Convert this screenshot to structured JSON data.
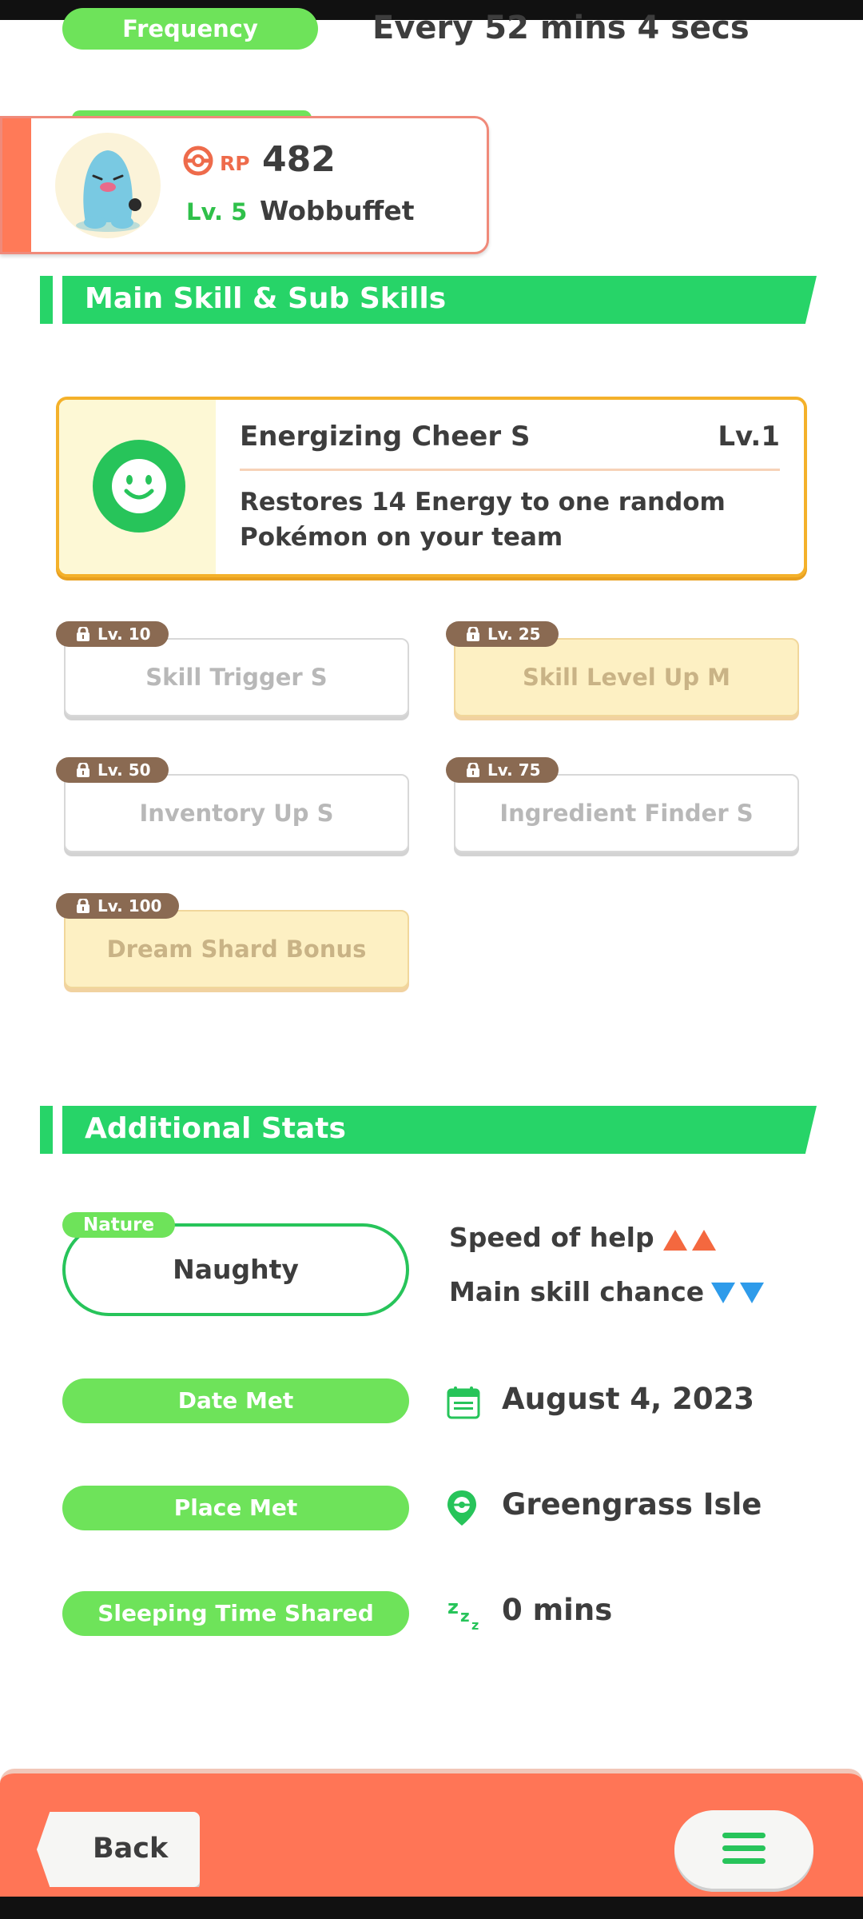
{
  "frequency": {
    "label": "Frequency",
    "value": "Every 52 mins 4 secs"
  },
  "pokemon": {
    "rp_label": "RP",
    "rp_value": "482",
    "level": "Lv. 5",
    "name": "Wobbuffet",
    "accent_color": "#ff7a58"
  },
  "section_skills": {
    "title": "Main Skill & Sub Skills"
  },
  "main_skill": {
    "name": "Energizing Cheer S",
    "level": "Lv.1",
    "description": "Restores 14 Energy to one random Pokémon on your team",
    "icon": "smile-face-icon"
  },
  "sub_skills": [
    {
      "unlock": "Lv. 10",
      "label": "Skill Trigger S",
      "tier": "silver"
    },
    {
      "unlock": "Lv. 25",
      "label": "Skill Level Up M",
      "tier": "gold"
    },
    {
      "unlock": "Lv. 50",
      "label": "Inventory Up S",
      "tier": "silver"
    },
    {
      "unlock": "Lv. 75",
      "label": "Ingredient Finder S",
      "tier": "silver"
    },
    {
      "unlock": "Lv. 100",
      "label": "Dream Shard Bonus",
      "tier": "gold"
    }
  ],
  "section_stats": {
    "title": "Additional Stats"
  },
  "nature": {
    "tag": "Nature",
    "value": "Naughty",
    "up_stat": "Speed of help",
    "down_stat": "Main skill chance",
    "up_color": "#f4683f",
    "down_color": "#2e9bea"
  },
  "info": {
    "date_met_label": "Date Met",
    "date_met_value": "August 4, 2023",
    "place_met_label": "Place Met",
    "place_met_value": "Greengrass Isle",
    "sleep_label": "Sleeping Time Shared",
    "sleep_value": "0 mins"
  },
  "nav": {
    "back_label": "Back",
    "menu_icon": "hamburger-menu-icon"
  },
  "colors": {
    "green": "#27d468",
    "light_green": "#6ee35a",
    "orange": "#ff7556"
  }
}
